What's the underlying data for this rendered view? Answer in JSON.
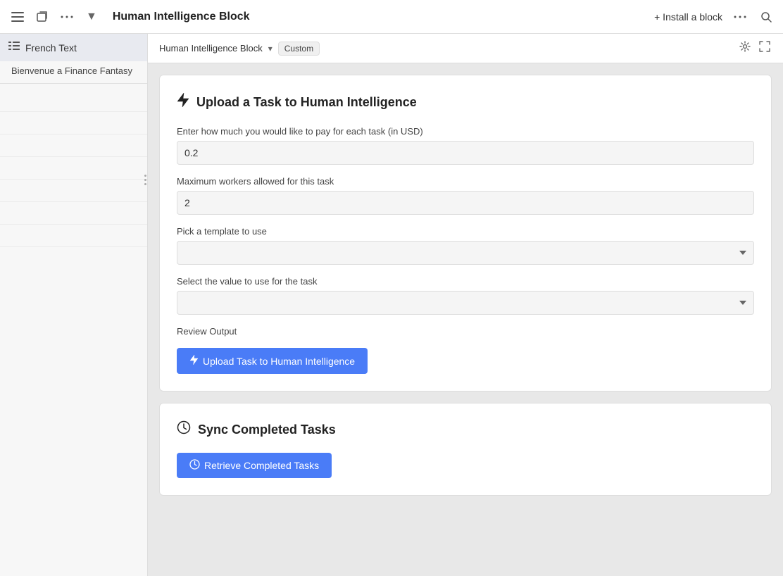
{
  "topBar": {
    "title": "Human Intelligence Block",
    "installBlockLabel": "+ Install a block",
    "moreOptionsIcon": "more-horizontal-icon",
    "searchIcon": "search-icon",
    "collapseIcon": "collapse-icon",
    "newTabIcon": "new-tab-icon"
  },
  "sidebar": {
    "mainItemIcon": "list-icon",
    "mainItemLabel": "French Text",
    "subItemLabel": "Bienvenue a Finance Fantasy"
  },
  "subHeader": {
    "breadcrumbTitle": "Human Intelligence Block",
    "tag": "Custom",
    "settingsIcon": "settings-icon",
    "expandIcon": "expand-icon"
  },
  "uploadCard": {
    "icon": "bolt-icon",
    "title": "Upload a Task to Human Intelligence",
    "payLabel": "Enter how much you would like to pay for each task (in USD)",
    "payValue": "0.2",
    "workersLabel": "Maximum workers allowed for this task",
    "workersValue": "2",
    "templateLabel": "Pick a template to use",
    "templatePlaceholder": "",
    "taskValueLabel": "Select the value to use for the task",
    "taskValuePlaceholder": "",
    "reviewOutputLabel": "Review Output",
    "uploadButtonLabel": "Upload Task to Human Intelligence",
    "uploadButtonIcon": "bolt-icon"
  },
  "syncCard": {
    "icon": "clock-icon",
    "title": "Sync Completed Tasks",
    "retrieveButtonLabel": "Retrieve Completed Tasks",
    "retrieveButtonIcon": "clock-icon"
  }
}
